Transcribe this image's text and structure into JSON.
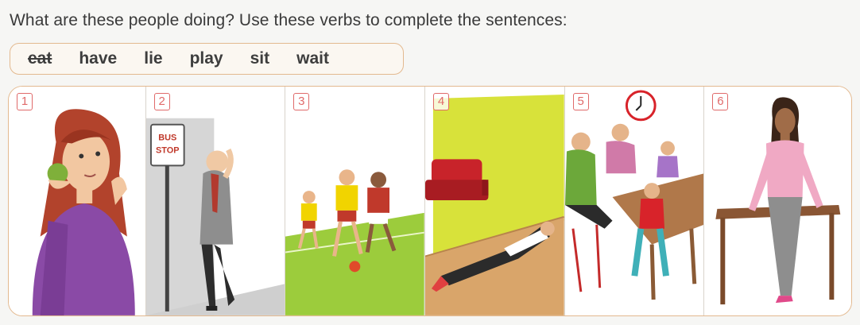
{
  "instruction": "What are these people doing?  Use these verbs to complete the sentences:",
  "verbs": [
    {
      "text": "eat",
      "crossed": true
    },
    {
      "text": "have",
      "crossed": false
    },
    {
      "text": "lie",
      "crossed": false
    },
    {
      "text": "play",
      "crossed": false
    },
    {
      "text": "sit",
      "crossed": false
    },
    {
      "text": "wait",
      "crossed": false
    }
  ],
  "panels": [
    {
      "number": "1",
      "illustration": "woman-eating-apple-illustration"
    },
    {
      "number": "2",
      "illustration": "man-at-bus-stop-illustration",
      "sign": [
        "BUS",
        "STOP"
      ]
    },
    {
      "number": "3",
      "illustration": "boys-playing-football-illustration"
    },
    {
      "number": "4",
      "illustration": "man-lying-on-floor-illustration"
    },
    {
      "number": "5",
      "illustration": "family-having-dinner-illustration"
    },
    {
      "number": "6",
      "illustration": "woman-sitting-on-table-illustration"
    }
  ],
  "colors": {
    "accent_border": "#e3b98f",
    "number_red": "#e06a6a"
  }
}
